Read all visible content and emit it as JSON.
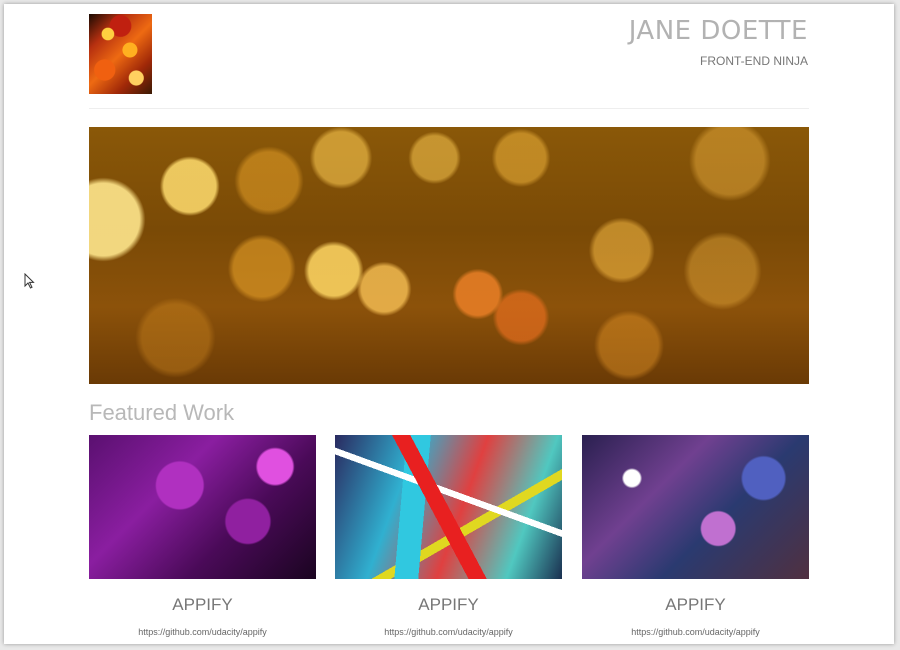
{
  "header": {
    "name": "JANE DOETTE",
    "subtitle": "FRONT-END NINJA"
  },
  "featured": {
    "title": "Featured Work",
    "items": [
      {
        "title": "APPIFY",
        "link": "https://github.com/udacity/appify"
      },
      {
        "title": "APPIFY",
        "link": "https://github.com/udacity/appify"
      },
      {
        "title": "APPIFY",
        "link": "https://github.com/udacity/appify"
      }
    ]
  },
  "colors": {
    "text_light": "#aaaaaa",
    "text_muted": "#777777",
    "background": "#ffffff"
  },
  "icons": {
    "cursor": "mouse-pointer-icon"
  }
}
